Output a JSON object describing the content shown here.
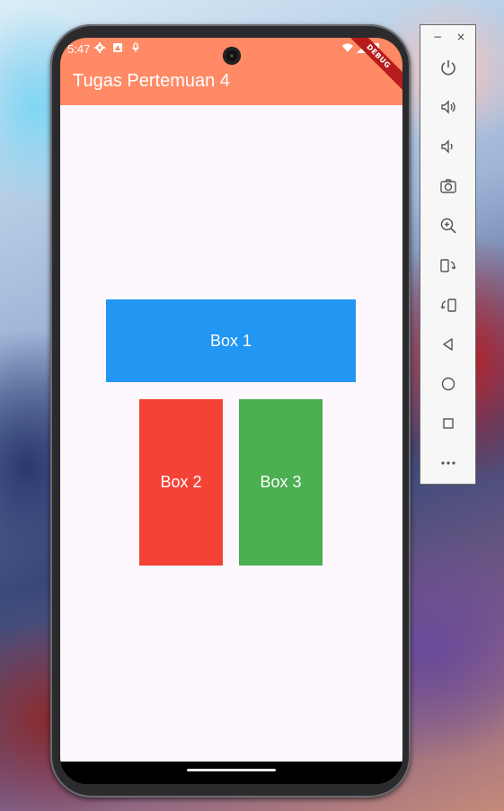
{
  "status_bar": {
    "time": "5:47"
  },
  "app_bar": {
    "title": "Tugas Pertemuan 4",
    "debug_label": "DEBUG"
  },
  "boxes": [
    {
      "label": "Box 1",
      "color": "#2196f3"
    },
    {
      "label": "Box 2",
      "color": "#f44336"
    },
    {
      "label": "Box 3",
      "color": "#4caf50"
    }
  ],
  "emulator_controls": [
    "power-icon",
    "volume-up-icon",
    "volume-down-icon",
    "camera-icon",
    "zoom-in-icon",
    "rotate-left-icon",
    "rotate-right-icon",
    "back-icon",
    "home-icon",
    "overview-icon",
    "more-icon"
  ],
  "colors": {
    "app_bar": "#ff8a65",
    "background": "#fdf7fe"
  }
}
